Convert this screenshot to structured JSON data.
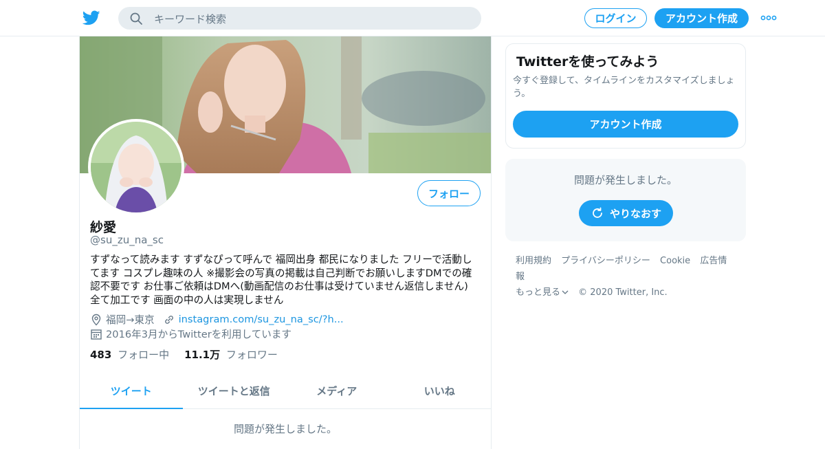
{
  "search": {
    "placeholder": "キーワード検索"
  },
  "header": {
    "login_label": "ログイン",
    "signup_label": "アカウント作成"
  },
  "profile": {
    "name": "紗愛",
    "handle": "@su_zu_na_sc",
    "follow_label": "フォロー",
    "bio": "すずなって読みます すずなぴって呼んで 福岡出身 都民になりました フリーで活動してます コスプレ趣味の人 ※撮影会の写真の掲載は自己判断でお願いしますDMでの確認不要です お仕事ご依頼はDMへ(動画配信のお仕事は受けていません返信しません) 全て加工です 画面の中の人は実現しません",
    "location": "福岡→東京",
    "url": "instagram.com/su_zu_na_sc/?h...",
    "joined": "2016年3月からTwitterを利用しています",
    "following_count": "483",
    "following_label": "フォロー中",
    "followers_count": "11.1万",
    "followers_label": "フォロワー"
  },
  "tabs": [
    {
      "label": "ツイート"
    },
    {
      "label": "ツイートと返信"
    },
    {
      "label": "メディア"
    },
    {
      "label": "いいね"
    }
  ],
  "main": {
    "error_message": "問題が発生しました。"
  },
  "sidebar": {
    "signup_card": {
      "title": "Twitterを使ってみよう",
      "description": "今すぐ登録して、タイムラインをカスタマイズしましょう。",
      "button_label": "アカウント作成"
    },
    "error_card": {
      "message": "問題が発生しました。",
      "retry_label": "やりなおす"
    },
    "footer": {
      "links": [
        "利用規約",
        "プライバシーポリシー",
        "Cookie",
        "広告情報",
        "もっと見る"
      ],
      "copyright": "© 2020 Twitter, Inc."
    }
  },
  "colors": {
    "accent": "#1da1f2",
    "secondary_text": "#657786",
    "border": "#e6ecf0"
  }
}
